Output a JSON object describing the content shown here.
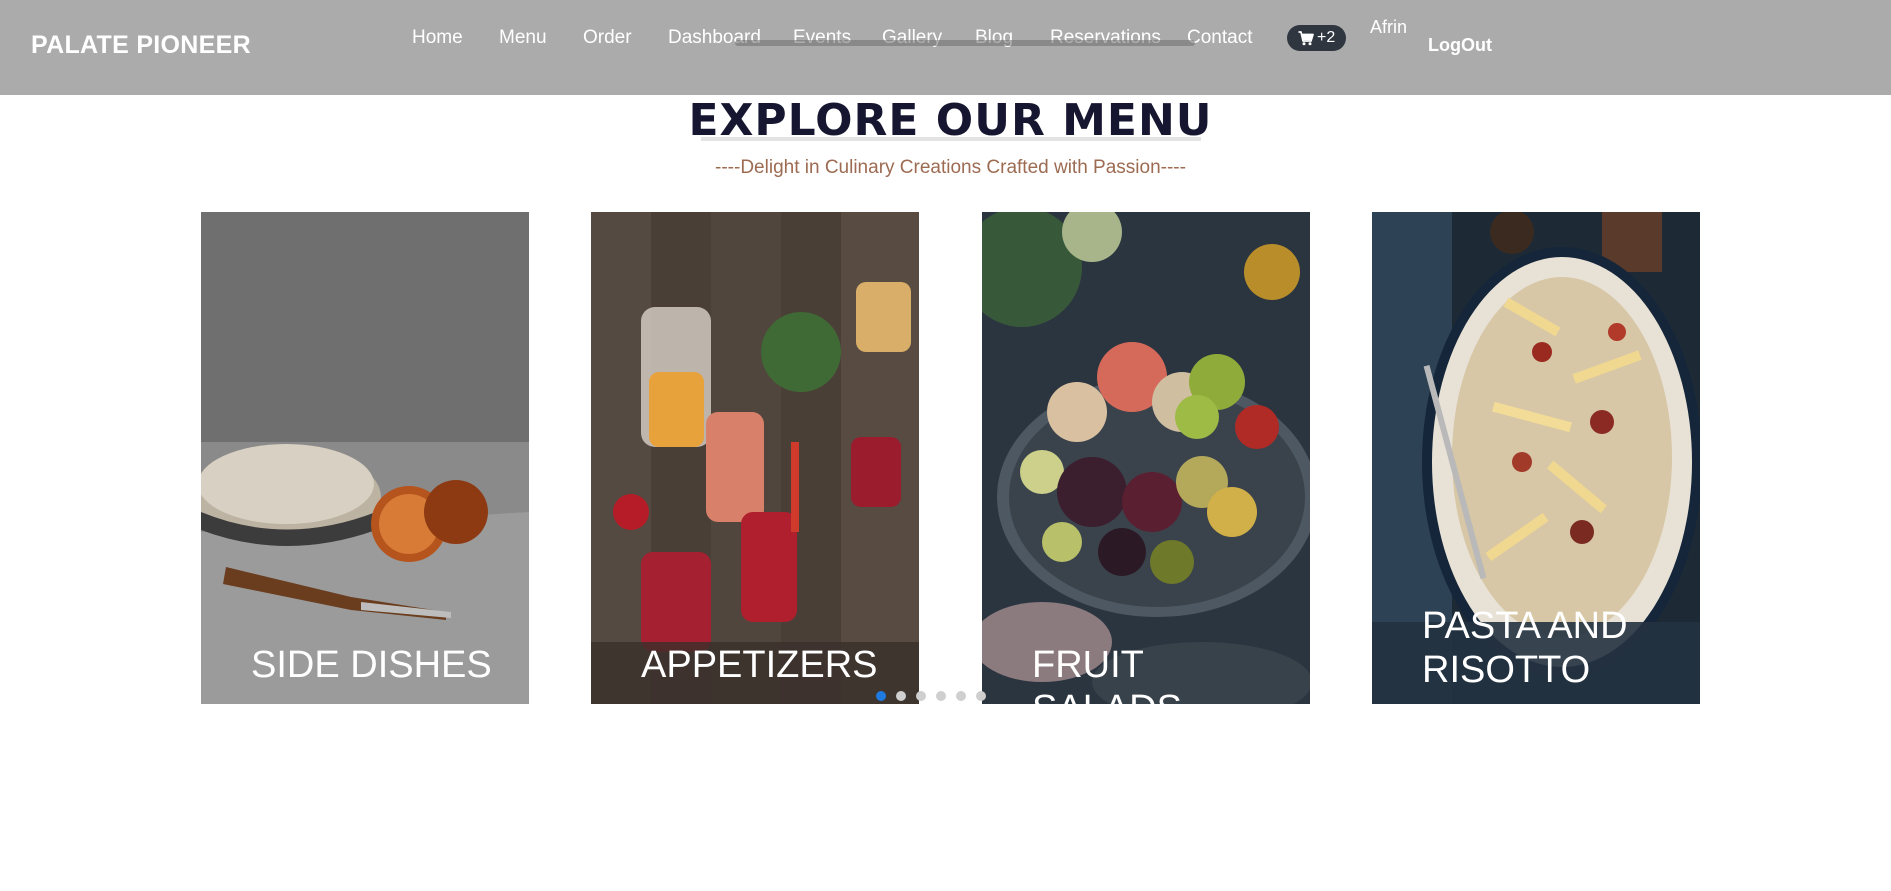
{
  "brand": "PALATE PIONEER",
  "nav": {
    "links": [
      {
        "label": "Home"
      },
      {
        "label": "Menu"
      },
      {
        "label": "Order"
      },
      {
        "label": "Dashboard"
      },
      {
        "label": "Events"
      },
      {
        "label": "Gallery"
      },
      {
        "label": "Blog"
      },
      {
        "label": "Reservations"
      },
      {
        "label": "Contact"
      }
    ],
    "cart_badge": "+2",
    "cart_icon": "cart-icon",
    "user_name": "Afrin",
    "logout_label": "LogOut"
  },
  "section": {
    "title": "EXPLORE OUR MENU",
    "subtitle": "----Delight in Culinary Creations Crafted with Passion----"
  },
  "cards": [
    {
      "label": "SIDE DISHES"
    },
    {
      "label": "APPETIZERS"
    },
    {
      "label": "FRUIT SALADS"
    },
    {
      "label": "PASTA AND RISOTTO"
    }
  ],
  "pagination": {
    "total": 6,
    "active": 1
  },
  "colors": {
    "navbar_bg": "#969696",
    "title": "#161630",
    "subtitle": "#9c6b52",
    "cart_pill": "#2f3640",
    "active_dot": "#1e7ae0",
    "inactive_dot": "#cfcfcf"
  }
}
